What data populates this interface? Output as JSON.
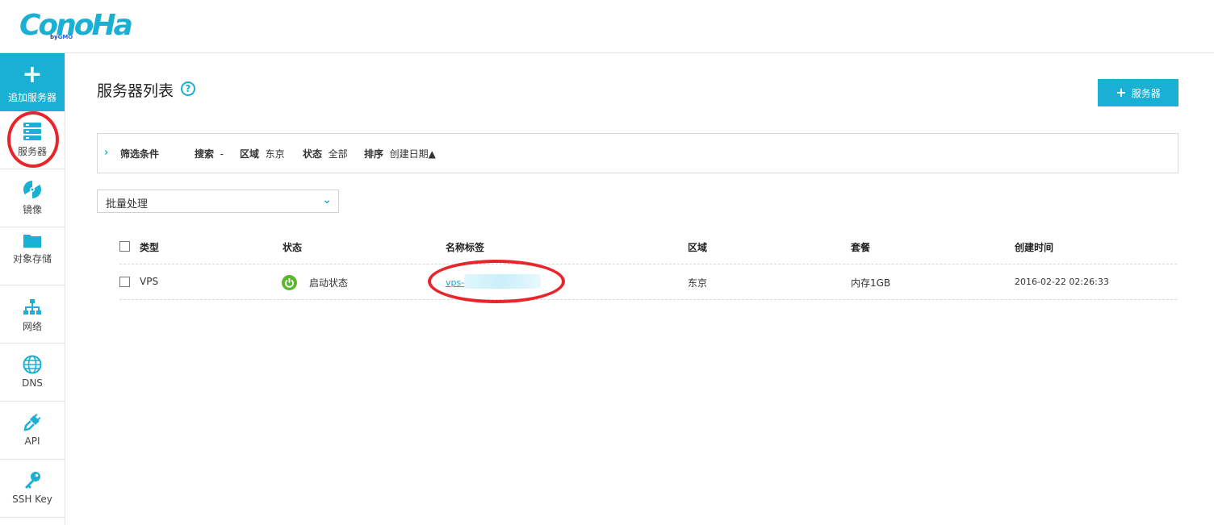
{
  "logo": {
    "main": "ConoHa",
    "sub_by": "by",
    "sub_brand": "GMO"
  },
  "sidebar": {
    "add": {
      "icon": "plus-icon",
      "label": "追加服务器"
    },
    "items": [
      {
        "icon": "server-icon",
        "label": "服务器"
      },
      {
        "icon": "disc-icon",
        "label": "镜像"
      },
      {
        "icon": "folder-icon",
        "label": "对象存储"
      },
      {
        "icon": "network-icon",
        "label": "网络"
      },
      {
        "icon": "globe-icon",
        "label": "DNS"
      },
      {
        "icon": "plug-icon",
        "label": "API"
      },
      {
        "icon": "key-icon",
        "label": "SSH Key"
      }
    ]
  },
  "header": {
    "title": "服务器列表",
    "help": "?",
    "add_button": "服务器"
  },
  "filter": {
    "chevron": "›",
    "title": "筛选条件",
    "search_label": "搜索",
    "search_value": "-",
    "region_label": "区域",
    "region_value": "东京",
    "status_label": "状态",
    "status_value": "全部",
    "sort_label": "排序",
    "sort_value": "创建日期▲"
  },
  "batch": {
    "label": "批量处理"
  },
  "table": {
    "headers": [
      "类型",
      "状态",
      "名称标签",
      "区域",
      "套餐",
      "创建时间"
    ],
    "rows": [
      {
        "type": "VPS",
        "status": "启动状态",
        "name": "vps-",
        "region": "东京",
        "plan": "内存1GB",
        "created": "2016-02-22 02:26:33"
      }
    ]
  },
  "colors": {
    "accent": "#1ab0d3",
    "status_on": "#5bb82e",
    "annotation": "#e8252b"
  }
}
